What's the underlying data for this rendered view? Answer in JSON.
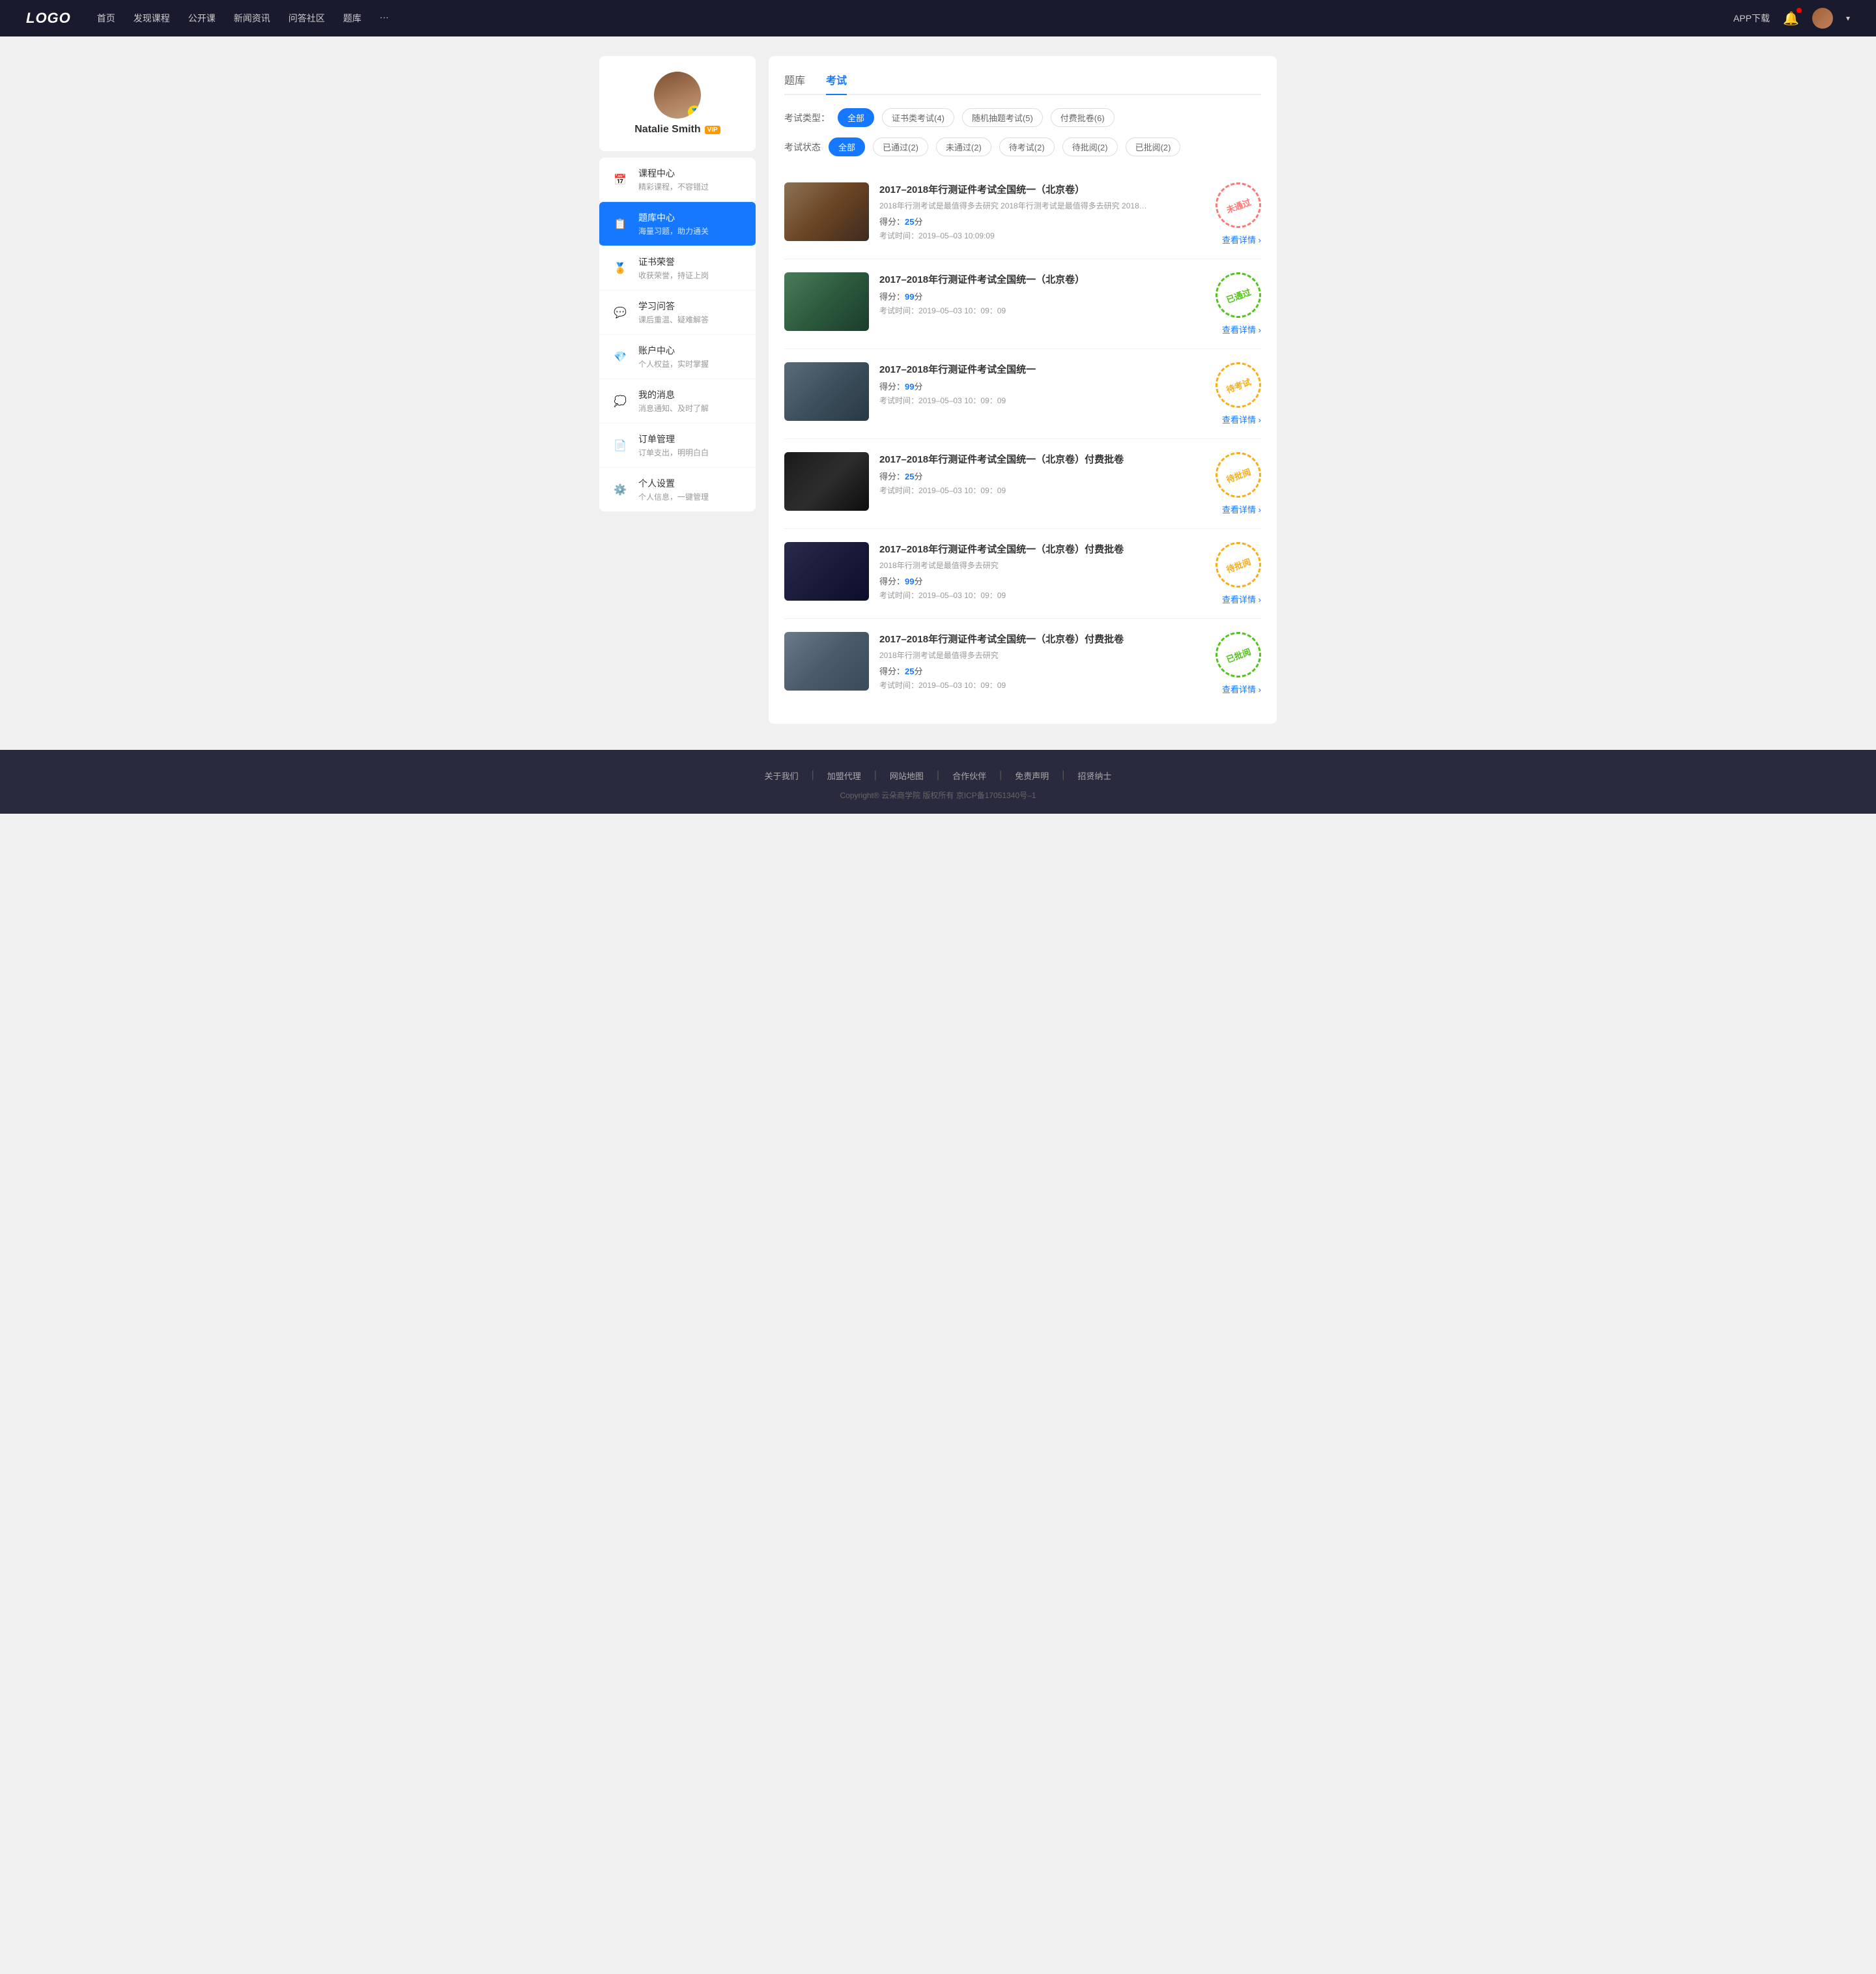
{
  "navbar": {
    "logo": "LOGO",
    "links": [
      {
        "label": "首页",
        "id": "nav-home"
      },
      {
        "label": "发现课程",
        "id": "nav-courses"
      },
      {
        "label": "公开课",
        "id": "nav-opencourse"
      },
      {
        "label": "新闻资讯",
        "id": "nav-news"
      },
      {
        "label": "问答社区",
        "id": "nav-qa"
      },
      {
        "label": "题库",
        "id": "nav-questions"
      },
      {
        "label": "···",
        "id": "nav-more"
      }
    ],
    "app_download": "APP下载",
    "user_name": "Natalie Smith"
  },
  "sidebar": {
    "username": "Natalie Smith",
    "vip_label": "VIP",
    "menu": [
      {
        "id": "course-center",
        "icon": "📅",
        "label": "课程中心",
        "sublabel": "精彩课程，不容错过",
        "active": false
      },
      {
        "id": "question-bank",
        "icon": "📋",
        "label": "题库中心",
        "sublabel": "海量习题，助力通关",
        "active": true
      },
      {
        "id": "certificate",
        "icon": "🏅",
        "label": "证书荣誉",
        "sublabel": "收获荣誉，持证上岗",
        "active": false
      },
      {
        "id": "study-qa",
        "icon": "💬",
        "label": "学习问答",
        "sublabel": "课后重温、疑难解答",
        "active": false
      },
      {
        "id": "account",
        "icon": "💎",
        "label": "账户中心",
        "sublabel": "个人权益，实时掌握",
        "active": false
      },
      {
        "id": "messages",
        "icon": "💭",
        "label": "我的消息",
        "sublabel": "消息通知、及时了解",
        "active": false
      },
      {
        "id": "orders",
        "icon": "📄",
        "label": "订单管理",
        "sublabel": "订单支出，明明白白",
        "active": false
      },
      {
        "id": "settings",
        "icon": "⚙️",
        "label": "个人设置",
        "sublabel": "个人信息，一键管理",
        "active": false
      }
    ]
  },
  "content": {
    "tabs": [
      {
        "label": "题库",
        "active": false
      },
      {
        "label": "考试",
        "active": true
      }
    ],
    "exam_type_filter": {
      "label": "考试类型：",
      "options": [
        {
          "label": "全部",
          "active": true
        },
        {
          "label": "证书类考试(4)",
          "active": false
        },
        {
          "label": "随机抽题考试(5)",
          "active": false
        },
        {
          "label": "付费批卷(6)",
          "active": false
        }
      ]
    },
    "exam_status_filter": {
      "label": "考试状态",
      "options": [
        {
          "label": "全部",
          "active": true
        },
        {
          "label": "已通过(2)",
          "active": false
        },
        {
          "label": "未通过(2)",
          "active": false
        },
        {
          "label": "待考试(2)",
          "active": false
        },
        {
          "label": "待批阅(2)",
          "active": false
        },
        {
          "label": "已批阅(2)",
          "active": false
        }
      ]
    },
    "exams": [
      {
        "id": "exam-1",
        "title": "2017–2018年行测证件考试全国统一（北京卷）",
        "desc": "2018年行测考试是最值得多去研究 2018年行测考试是最值得多去研究 2018年行...",
        "score_label": "得分：",
        "score": "25",
        "score_unit": "分",
        "time_label": "考试时间：",
        "time": "2019–05–03  10:09:09",
        "status": "未通过",
        "status_type": "notpass",
        "detail_label": "查看详情",
        "thumb_class": "thumb-1"
      },
      {
        "id": "exam-2",
        "title": "2017–2018年行测证件考试全国统一（北京卷）",
        "desc": "",
        "score_label": "得分：",
        "score": "99",
        "score_unit": "分",
        "time_label": "考试时间：",
        "time": "2019–05–03  10：09：09",
        "status": "已通过",
        "status_type": "passed",
        "detail_label": "查看详情",
        "thumb_class": "thumb-2"
      },
      {
        "id": "exam-3",
        "title": "2017–2018年行测证件考试全国统一",
        "desc": "",
        "score_label": "得分：",
        "score": "99",
        "score_unit": "分",
        "time_label": "考试时间：",
        "time": "2019–05–03  10：09：09",
        "status": "待考试",
        "status_type": "pending",
        "detail_label": "查看详情",
        "thumb_class": "thumb-3"
      },
      {
        "id": "exam-4",
        "title": "2017–2018年行测证件考试全国统一（北京卷）付费批卷",
        "desc": "",
        "score_label": "得分：",
        "score": "25",
        "score_unit": "分",
        "time_label": "考试时间：",
        "time": "2019–05–03  10：09：09",
        "status": "待批阅",
        "status_type": "review",
        "detail_label": "查看详情",
        "thumb_class": "thumb-4"
      },
      {
        "id": "exam-5",
        "title": "2017–2018年行测证件考试全国统一（北京卷）付费批卷",
        "desc": "2018年行测考试是最值得多去研究",
        "score_label": "得分：",
        "score": "99",
        "score_unit": "分",
        "time_label": "考试时间：",
        "time": "2019–05–03  10：09：09",
        "status": "待批阅",
        "status_type": "review",
        "detail_label": "查看详情",
        "thumb_class": "thumb-5"
      },
      {
        "id": "exam-6",
        "title": "2017–2018年行测证件考试全国统一（北京卷）付费批卷",
        "desc": "2018年行测考试是最值得多去研究",
        "score_label": "得分：",
        "score": "25",
        "score_unit": "分",
        "time_label": "考试时间：",
        "time": "2019–05–03  10：09：09",
        "status": "已批阅",
        "status_type": "reviewed",
        "detail_label": "查看详情",
        "thumb_class": "thumb-6"
      }
    ]
  },
  "footer": {
    "links": [
      {
        "label": "关于我们"
      },
      {
        "label": "加盟代理"
      },
      {
        "label": "网站地图"
      },
      {
        "label": "合作伙伴"
      },
      {
        "label": "免责声明"
      },
      {
        "label": "招贤纳士"
      }
    ],
    "copyright": "Copyright® 云朵商学院  版权所有    京ICP备17051340号–1"
  }
}
